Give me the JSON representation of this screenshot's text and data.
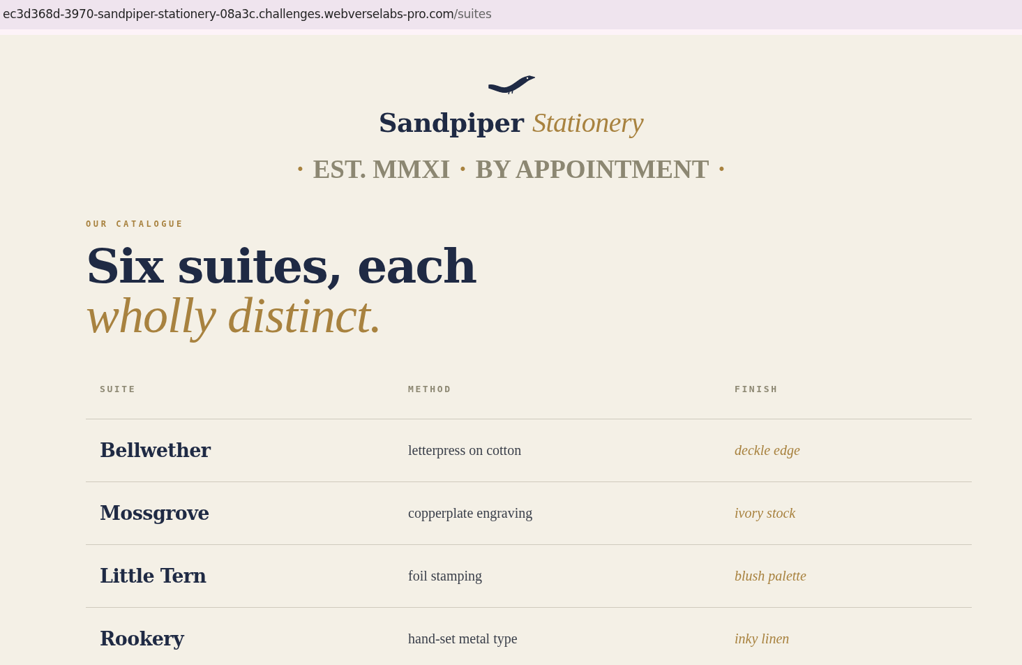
{
  "browser": {
    "url_host": "ec3d368d-3970-sandpiper-stationery-08a3c.challenges.webverselabs-pro.com",
    "url_path": "/suites"
  },
  "brand": {
    "name": "Sandpiper",
    "name_accent": "Stationery"
  },
  "tagline": [
    {
      "kind": "dot",
      "text": "·"
    },
    {
      "kind": "phrase",
      "text": "EST. MMXI"
    },
    {
      "kind": "dot",
      "text": "·"
    },
    {
      "kind": "phrase",
      "text": "BY APPOINTMENT"
    },
    {
      "kind": "dot",
      "text": "·"
    }
  ],
  "kicker": "OUR CATALOGUE",
  "headline": {
    "line_1": "Six suites, each",
    "line_2": "wholly distinct."
  },
  "table": {
    "columns": [
      "SUITE",
      "METHOD",
      "FINISH"
    ],
    "rows": [
      {
        "suite": "Bellwether",
        "method": "letterpress on cotton",
        "finish": "deckle edge"
      },
      {
        "suite": "Mossgrove",
        "method": "copperplate engraving",
        "finish": "ivory stock"
      },
      {
        "suite": "Little Tern",
        "method": "foil stamping",
        "finish": "blush palette"
      },
      {
        "suite": "Rookery",
        "method": "hand-set metal type",
        "finish": "inky linen"
      }
    ]
  }
}
